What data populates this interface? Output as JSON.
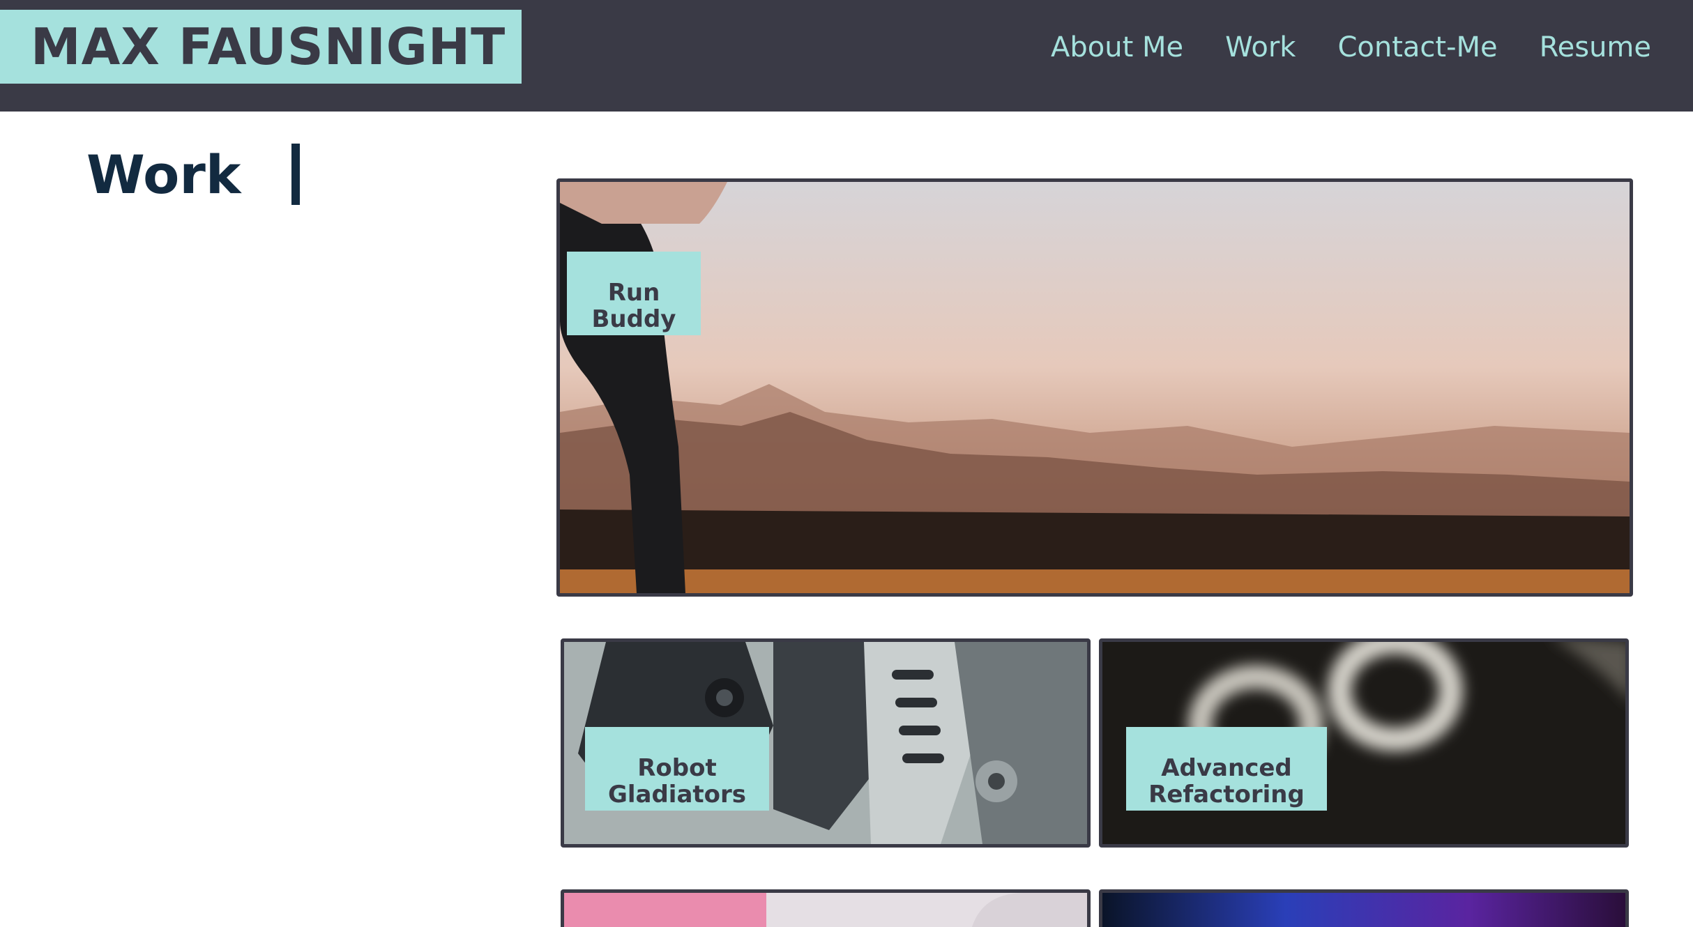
{
  "header": {
    "brand": "MAX FAUSNIGHT",
    "nav": [
      "About Me",
      "Work",
      "Contact-Me",
      "Resume"
    ]
  },
  "work": {
    "title": "Work",
    "projects": [
      {
        "label": "Run Buddy",
        "art": "sunset-mountains-runner-photo"
      },
      {
        "label": "Robot Gladiators",
        "art": "robot-machinery-photo"
      },
      {
        "label": "Advanced Refactoring",
        "art": "blurred-code-photo"
      },
      {
        "label": "",
        "art": "pink-abstract-photo"
      },
      {
        "label": "",
        "art": "blue-purple-abstract-photo"
      }
    ]
  },
  "colors": {
    "header_bg": "#3a3a46",
    "accent": "#a5e1dd",
    "title_text": "#122a40",
    "page_bg": "#ffffff"
  }
}
